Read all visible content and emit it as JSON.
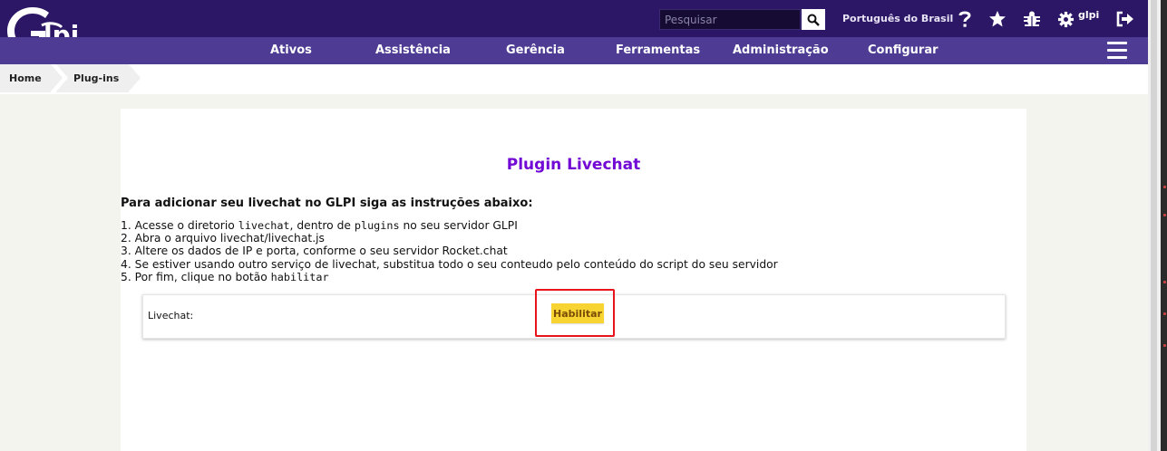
{
  "header": {
    "logo_text": "Glpi",
    "search_placeholder": "Pesquisar",
    "language": "Português do Brasil",
    "user": "glpi"
  },
  "nav": {
    "items": [
      "Ativos",
      "Assistência",
      "Gerência",
      "Ferramentas",
      "Administração",
      "Configurar"
    ]
  },
  "breadcrumb": [
    "Home",
    "Plug-ins"
  ],
  "content": {
    "title": "Plugin Livechat",
    "intro": "Para adicionar seu livechat no GLPI siga as instruções abaixo:",
    "steps": [
      {
        "before": "1. Acesse o diretorio ",
        "code1": "livechat",
        "mid": ", dentro de ",
        "code2": "plugins",
        "after": " no seu servidor GLPI"
      },
      {
        "text": "2. Abra o arquivo livechat/livechat.js"
      },
      {
        "text": "3. Altere os dados de IP e porta, conforme o seu servidor Rocket.chat"
      },
      {
        "text": "4. Se estiver usando outro serviço de livechat, substitua todo o seu conteudo pelo conteúdo do script do seu servidor"
      },
      {
        "before": "5. Por fim, clique no botão ",
        "code1": "habilitar"
      }
    ],
    "form_label": "Livechat:",
    "enable_button": "Habilitar"
  },
  "colors": {
    "topbar": "#2c1766",
    "navbar": "#4d3b94",
    "title": "#7209d4",
    "button": "#f7d431",
    "highlight": "#e8141c"
  },
  "icons": [
    "search-icon",
    "help-icon",
    "star-icon",
    "bug-icon",
    "gear-icon",
    "logout-icon",
    "menu-icon"
  ]
}
